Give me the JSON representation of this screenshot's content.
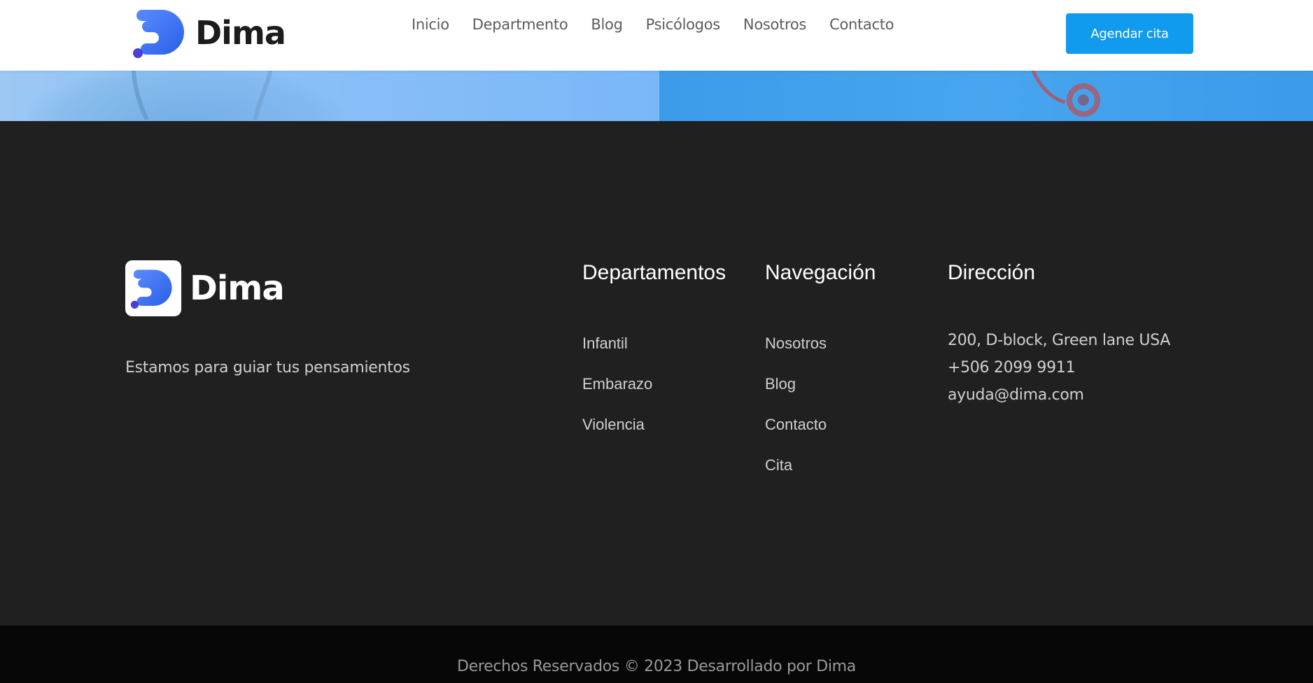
{
  "header": {
    "brand": "Dima",
    "nav": [
      "Inicio",
      "Departmento",
      "Blog",
      "Psicólogos",
      "Nosotros",
      "Contacto"
    ],
    "cta_label": "Agendar cita"
  },
  "colors": {
    "accent": "#119bee",
    "logo_blue": "#2f6fe8",
    "footer_bg": "#202020",
    "bottom_bar_bg": "#070707"
  },
  "footer": {
    "brand": "Dima",
    "tagline": "Estamos para guiar tus pensamientos",
    "departamentos": {
      "title": "Departamentos",
      "items": [
        "Infantil",
        "Embarazo",
        "Violencia"
      ]
    },
    "navegacion": {
      "title": "Navegación",
      "items": [
        "Nosotros",
        "Blog",
        "Contacto",
        "Cita"
      ]
    },
    "direccion": {
      "title": "Dirección",
      "address": "200, D-block, Green lane USA",
      "phone": "+506 2099 9911",
      "email": "ayuda@dima.com"
    }
  },
  "copyright": "Derechos Reservados © 2023 Desarrollado por Dima"
}
